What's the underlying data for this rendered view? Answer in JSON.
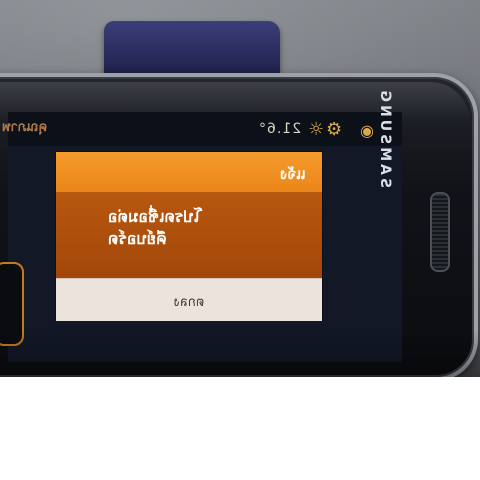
{
  "status_bar": {
    "left_text": "คุณภาพ",
    "clock": "21.6°",
    "icons": [
      "sun-icon",
      "gear-icon",
      "eye-icon"
    ]
  },
  "dialog": {
    "title": "แจ้ง",
    "message": "โปรดเชื่อมต่อ\nคีย์บอร์ด",
    "button_label": "ตกลง"
  },
  "device": {
    "brand": "SAMSUNG"
  },
  "colors": {
    "dialog_header": "#f59b2c",
    "dialog_body": "#a3470a",
    "dialog_button": "#ece4dc",
    "phone_body": "#0b0c10",
    "clip": "#262858"
  }
}
